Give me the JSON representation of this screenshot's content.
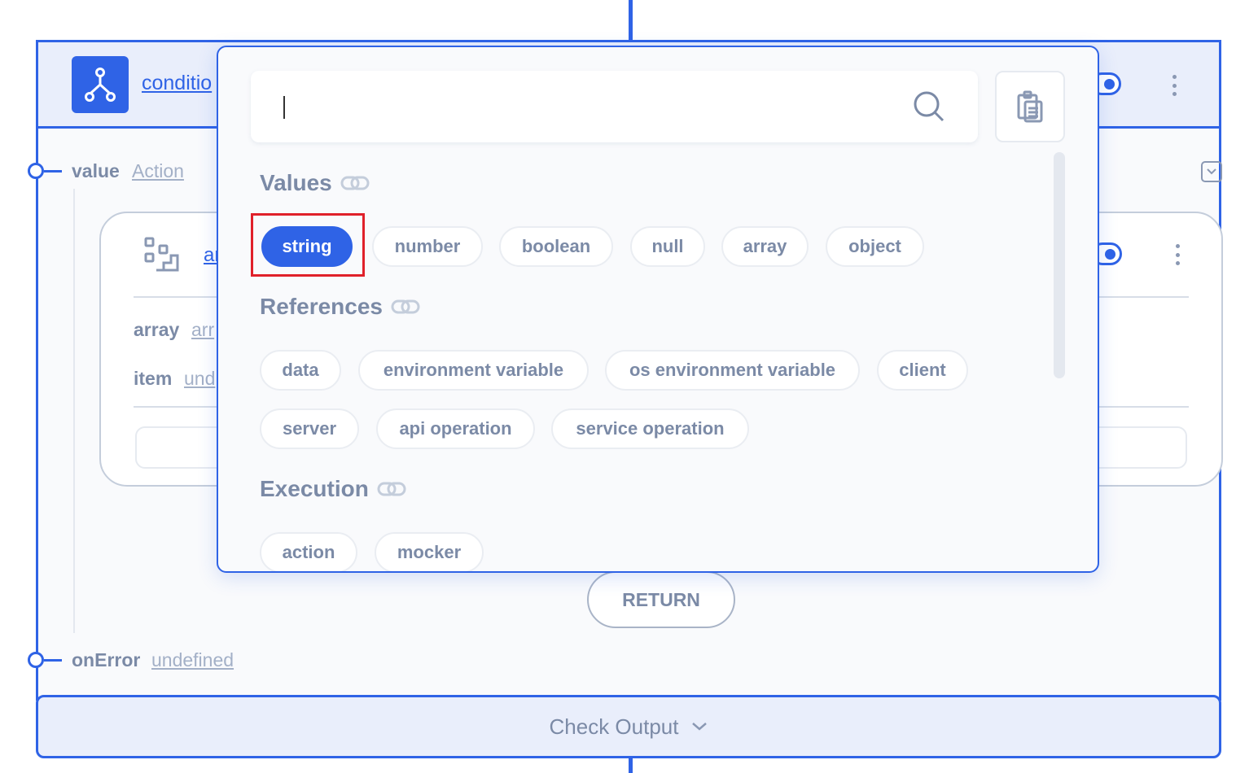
{
  "colors": {
    "accent": "#2f63e6",
    "text_muted": "#7b8aa6",
    "highlight": "#e0202a"
  },
  "node": {
    "title": "conditio",
    "icon": "branch-icon"
  },
  "fields": {
    "value": {
      "label": "value",
      "link": "Action"
    },
    "onError": {
      "label": "onError",
      "link": "undefined"
    }
  },
  "inner_node": {
    "title": "ar",
    "icon": "array-blocks-icon",
    "fields": [
      {
        "label": "array",
        "link": "arr"
      },
      {
        "label": "item",
        "link": "und"
      }
    ]
  },
  "return_label": "RETURN",
  "check_output_label": "Check Output",
  "popover": {
    "search": {
      "value": "",
      "icon": "search-icon"
    },
    "paste_icon": "clipboard-icon",
    "sections": {
      "values": {
        "title": "Values",
        "chips": [
          "string",
          "number",
          "boolean",
          "null",
          "array",
          "object"
        ],
        "selected": "string"
      },
      "references": {
        "title": "References",
        "chips": [
          "data",
          "environment variable",
          "os environment variable",
          "client",
          "server",
          "api operation",
          "service operation"
        ]
      },
      "execution": {
        "title": "Execution",
        "chips": [
          "action",
          "mocker"
        ]
      }
    }
  }
}
